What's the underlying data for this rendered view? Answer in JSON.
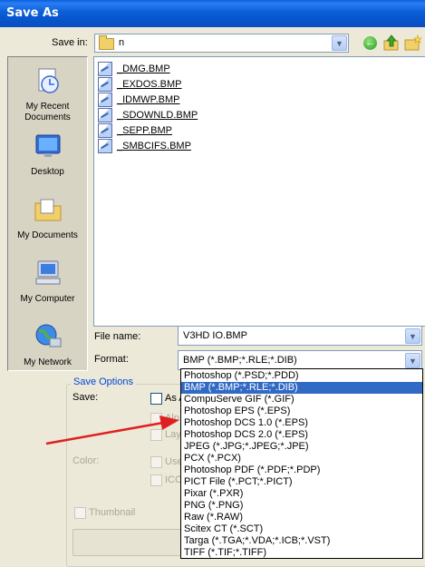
{
  "window": {
    "title": "Save As"
  },
  "toolbar": {
    "save_in_label": "Save in:",
    "save_in_value": "n"
  },
  "places": [
    {
      "name": "my-recent-documents",
      "label_line1": "My Recent",
      "label_line2": "Documents"
    },
    {
      "name": "desktop",
      "label_line1": "Desktop",
      "label_line2": ""
    },
    {
      "name": "my-documents",
      "label_line1": "My Documents",
      "label_line2": ""
    },
    {
      "name": "my-computer",
      "label_line1": "My Computer",
      "label_line2": ""
    },
    {
      "name": "my-network",
      "label_line1": "My Network",
      "label_line2": ""
    }
  ],
  "files": [
    "_DMG.BMP",
    "_EXDOS.BMP",
    "_IDMWP.BMP",
    "_SDOWNLD.BMP",
    "_SEPP.BMP",
    "_SMBCIFS.BMP"
  ],
  "form": {
    "file_name_label": "File name:",
    "file_name_value": "V3HD IO.BMP",
    "format_label": "Format:",
    "format_value": "BMP (*.BMP;*.RLE;*.DIB)"
  },
  "save_options": {
    "title": "Save Options",
    "save_label": "Save:",
    "as_copy": "As A",
    "alpha": "Alp",
    "layers": "Lay",
    "color_label": "Color:",
    "use_proof": "Use",
    "icc": "ICC",
    "thumbnail": "Thumbnail"
  },
  "format_options": [
    "Photoshop (*.PSD;*.PDD)",
    "BMP (*.BMP;*.RLE;*.DIB)",
    "CompuServe GIF (*.GIF)",
    "Photoshop EPS (*.EPS)",
    "Photoshop DCS 1.0 (*.EPS)",
    "Photoshop DCS 2.0 (*.EPS)",
    "JPEG (*.JPG;*.JPEG;*.JPE)",
    "PCX (*.PCX)",
    "Photoshop PDF (*.PDF;*.PDP)",
    "PICT File (*.PCT;*.PICT)",
    "Pixar (*.PXR)",
    "PNG (*.PNG)",
    "Raw (*.RAW)",
    "Scitex CT (*.SCT)",
    "Targa (*.TGA;*.VDA;*.ICB;*.VST)",
    "TIFF (*.TIF;*.TIFF)"
  ],
  "selected_format_index": 1,
  "colors": {
    "title_bar": "#0a5fdc",
    "selection": "#316ac5",
    "annotation_arrow": "#e02020",
    "dialog_bg": "#ece9d8"
  },
  "icons": [
    "back-icon",
    "up-folder-icon",
    "new-folder-icon",
    "folder-icon",
    "bmp-file-icon",
    "dropdown-arrow-icon"
  ]
}
